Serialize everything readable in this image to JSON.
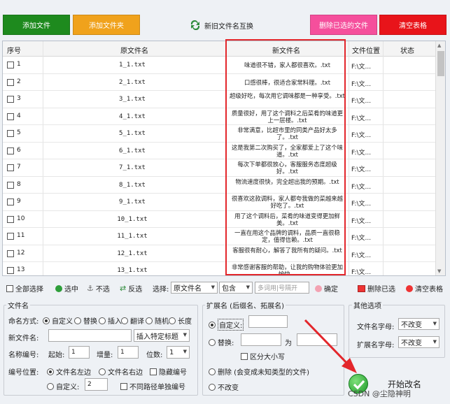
{
  "toolbar": {
    "add_file": "添加文件",
    "add_folder": "添加文件夹",
    "swap_names": "新旧文件名互换",
    "delete_selected": "删除已选的文件",
    "clear_table": "清空表格",
    "colors": {
      "add_file": "#1e8a1e",
      "add_folder": "#f0a21c",
      "delete_selected": "#f54f9c",
      "clear_table": "#e8141a"
    }
  },
  "table": {
    "headers": {
      "no": "序号",
      "original": "原文件名",
      "new": "新文件名",
      "location": "文件位置",
      "status": "状态"
    },
    "rows": [
      {
        "no": "1",
        "original": "1_1.txt",
        "new": "味道很不错，家人都很喜欢。.txt",
        "location": "F:\\文..."
      },
      {
        "no": "2",
        "original": "2_1.txt",
        "new": "口感很棒，很适合家常料理。.txt",
        "location": "F:\\文..."
      },
      {
        "no": "3",
        "original": "3_1.txt",
        "new": "超级好吃，每次用它调味都是一种享受。.txt",
        "location": "F:\\文..."
      },
      {
        "no": "4",
        "original": "4_1.txt",
        "new": "质量很好，用了这个调料之后菜肴的味道更上一层楼。.txt",
        "location": "F:\\文..."
      },
      {
        "no": "5",
        "original": "5_1.txt",
        "new": "非常满意，比超市里的同类产品好太多了。.txt",
        "location": "F:\\文..."
      },
      {
        "no": "6",
        "original": "6_1.txt",
        "new": "这是我第二次购买了，全家都爱上了这个味道。.txt",
        "location": "F:\\文..."
      },
      {
        "no": "7",
        "original": "7_1.txt",
        "new": "每次下单都很放心，客服服务态度超级好。.txt",
        "location": "F:\\文..."
      },
      {
        "no": "8",
        "original": "8_1.txt",
        "new": "物流速度很快，完全超出我的预期。.txt",
        "location": "F:\\文..."
      },
      {
        "no": "9",
        "original": "9_1.txt",
        "new": "很喜欢这款调料，家人都夸我做的菜越来越好吃了。.txt",
        "location": "F:\\文..."
      },
      {
        "no": "10",
        "original": "10_1.txt",
        "new": "用了这个调料后，菜肴的味道变得更加鲜美。.txt",
        "location": "F:\\文..."
      },
      {
        "no": "11",
        "original": "11_1.txt",
        "new": "一直在用这个品牌的调料，品质一直很稳定，值得信赖。.txt",
        "location": "F:\\文..."
      },
      {
        "no": "12",
        "original": "12_1.txt",
        "new": "客服很有耐心，解答了我所有的疑问。.txt",
        "location": "F:\\文..."
      },
      {
        "no": "13",
        "original": "13_1.txt",
        "new": "非常感谢客服的帮助，让我的购物体验更加愉快。",
        "location": "F:\\文..."
      }
    ]
  },
  "selbar": {
    "select_all": "全部选择",
    "select": "选中",
    "deselect": "不选",
    "invert": "反选",
    "choose": "选择:",
    "field_value": "原文件名",
    "mode_value": "包含",
    "separator_placeholder": "多词用|号隔开",
    "confirm": "确定",
    "delete_selected": "删除已选",
    "clear_table": "清空表格"
  },
  "filename": {
    "title": "文件名",
    "mode_label": "命名方式:",
    "modes": [
      "自定义",
      "替换",
      "插入",
      "翻译",
      "随机",
      "长度"
    ],
    "new_name_label": "新文件名:",
    "insert_title": "插入特定标题",
    "numbering_label": "名称编号:",
    "start_label": "起始:",
    "start_value": "1",
    "increment_label": "增量:",
    "increment_value": "1",
    "digits_label": "位数:",
    "digits_value": "1",
    "position_label": "编号位置:",
    "pos_left": "文件名左边",
    "pos_right": "文件名右边",
    "hide_number": "隐藏编号",
    "pos_custom": "自定义:",
    "custom_value": "2",
    "separate_path": "不同路径单独编号"
  },
  "extension": {
    "title": "扩展名 (后缀名、拓展名)",
    "custom": "自定义:",
    "replace": "替换:",
    "to": "为",
    "case_sensitive": "区分大小写",
    "delete": "删除 (会变成未知类型的文件)",
    "no_change": "不改变"
  },
  "other": {
    "title": "其他选项",
    "filename_case_label": "文件名字母:",
    "filename_case_value": "不改变",
    "ext_case_label": "扩展名字母:",
    "ext_case_value": "不改变"
  },
  "start": {
    "label": "开始改名"
  },
  "watermark": "CSDN @尘隐神明"
}
